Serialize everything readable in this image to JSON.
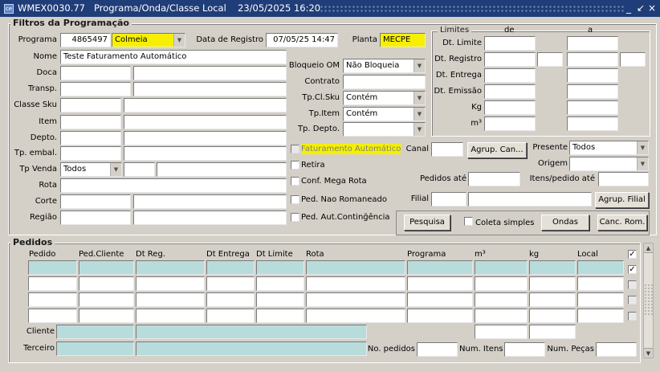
{
  "window": {
    "code": "WMEX0030.77",
    "title": "Programa/Onda/Classe Local",
    "datetime": "23/05/2025 16:20",
    "btn_min": "_",
    "btn_restore": "↙",
    "btn_close": "×"
  },
  "filtros": {
    "legend": "Filtros da Programação",
    "programa_label": "Programa",
    "programa_value": "4865497",
    "programa_name": "Colmeia",
    "dt_registro_label": "Data de Registro",
    "dt_registro_value": "07/05/25 14:47",
    "planta_label": "Planta",
    "planta_value": "MECPE",
    "nome_label": "Nome",
    "nome_value": "Teste Faturamento Automático",
    "doca_label": "Doca",
    "transp_label": "Transp.",
    "classe_sku_label": "Classe Sku",
    "item_label": "Item",
    "depto_label": "Depto.",
    "tp_embal_label": "Tp. embal.",
    "tp_venda_label": "Tp Venda",
    "tp_venda_value": "Todos",
    "rota_label": "Rota",
    "corte_label": "Corte",
    "regiao_label": "Região",
    "bloqueio_label": "Bloqueio OM",
    "bloqueio_value": "Não Bloqueia",
    "contrato_label": "Contrato",
    "tp_cl_sku_label": "Tp.Cl.Sku",
    "tp_cl_sku_value": "Contém",
    "tp_item_label": "Tp.Item",
    "tp_item_value": "Contém",
    "tp_depto_label": "Tp. Depto.",
    "chk_fat_auto": "Faturamento Automático",
    "chk_retira": "Retira",
    "chk_conf_mega": "Conf. Mega Rota",
    "chk_ped_nao_rom": "Ped. Nao Romaneado",
    "chk_ped_aut_cont": "Ped. Aut.Continğência",
    "canal_label": "Canal",
    "agrup_can_btn": "Agrup. Can...",
    "presente_label": "Presente",
    "presente_value": "Todos",
    "origem_label": "Origem",
    "pedidos_ate_label": "Pedidos até",
    "itens_pedido_ate_label": "Itens/pedido até",
    "filial_label": "Filial",
    "agrup_filial_btn": "Agrup. Filial",
    "pesquisa_btn": "Pesquisa",
    "coleta_simples": "Coleta simples",
    "ondas_btn": "Ondas",
    "canc_rom_btn": "Canc. Rom."
  },
  "limites": {
    "legend": "Limites",
    "de_label": "de",
    "a_label": "a",
    "rows": [
      "Dt. Limite",
      "Dt. Registro",
      "Dt. Entrega",
      "Dt. Emissão",
      "Kg",
      "m³"
    ]
  },
  "pedidos": {
    "legend": "Pedidos",
    "columns": [
      "Pedido",
      "Ped.Cliente",
      "Dt Reg.",
      "Dt Entrega",
      "Dt Limite",
      "Rota",
      "Programa",
      "m³",
      "kg",
      "Local"
    ],
    "checks": [
      "✓",
      "✓",
      "",
      "",
      ""
    ],
    "cliente_label": "Cliente",
    "terceiro_label": "Terceiro",
    "no_pedidos_label": "No. pedidos",
    "num_itens_label": "Num. Itens",
    "num_pecas_label": "Num. Peças"
  },
  "icons": {
    "app": "app-icon",
    "dropdown": "chevron-down-icon",
    "scroll_up": "arrow-up-icon",
    "scroll_down": "arrow-down-icon"
  }
}
